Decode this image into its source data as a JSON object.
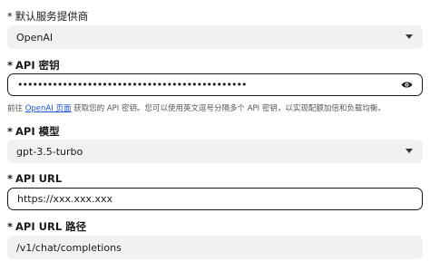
{
  "provider": {
    "label": "默认服务提供商",
    "value": "OpenAI"
  },
  "api_key": {
    "label": "API 密钥",
    "value": "••••••••••••••••••••••••••••••••••••••••••••••"
  },
  "help": {
    "prefix": "前往",
    "link": "OpenAI 页面",
    "suffix": "获取您的 API 密钥。您可以使用英文逗号分隔多个 API 密钥，以实现配额加倍和负载均衡。"
  },
  "model": {
    "label": "API 模型",
    "value": "gpt-3.5-turbo"
  },
  "api_url": {
    "label": "API URL",
    "value": "https://xxx.xxx.xxx"
  },
  "api_url_path": {
    "label": "API URL 路径",
    "value": "/v1/chat/completions"
  },
  "required_mark": "*",
  "icons": {
    "provider_select": "chevron-down-icon",
    "api_key_toggle": "eye-icon",
    "model_select": "chevron-down-icon"
  },
  "colors": {
    "field_bg": "#f1f1f1",
    "outline": "#1a1a1a",
    "link": "#1a56db"
  }
}
